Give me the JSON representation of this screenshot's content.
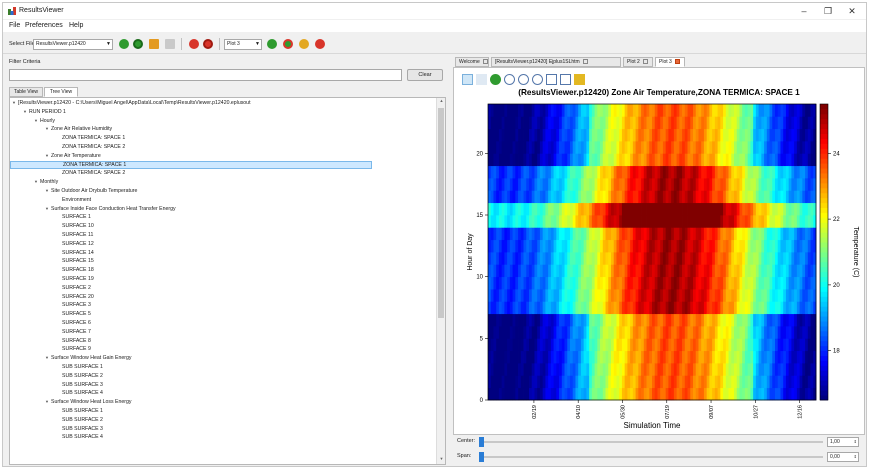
{
  "window": {
    "title": "ResultsViewer"
  },
  "menu": [
    "File",
    "Preferences",
    "Help"
  ],
  "toolbar": {
    "select_label": "Select File",
    "file_value": "ResultsViewer.p12420",
    "plot_value": "Plot 3"
  },
  "left": {
    "filter_label": "Filter Criteria",
    "filter_value": "",
    "clear_label": "Clear",
    "tabs": [
      "Table View",
      "Tree View"
    ],
    "tree": [
      {
        "text": "[ResultsViewer.p12420 - C:\\Users\\Miguel Angel\\AppData\\Local\\Temp\\ResultsViewer.p12420.eplusout",
        "depth": 0,
        "exp": true
      },
      {
        "text": "RUN PERIOD 1",
        "depth": 1,
        "exp": true
      },
      {
        "text": "Hourly",
        "depth": 2,
        "exp": true
      },
      {
        "text": "Zone Air Relative Humidity",
        "depth": 3,
        "exp": true
      },
      {
        "text": "ZONA TERMICA: SPACE 1",
        "depth": 4
      },
      {
        "text": "ZONA TERMICA: SPACE 2",
        "depth": 4
      },
      {
        "text": "Zone Air Temperature",
        "depth": 3,
        "exp": true
      },
      {
        "text": "ZONA TERMICA: SPACE 1",
        "depth": 4,
        "sel": true
      },
      {
        "text": "ZONA TERMICA: SPACE 2",
        "depth": 4
      },
      {
        "text": "Monthly",
        "depth": 2,
        "exp": true
      },
      {
        "text": "Site Outdoor Air Drybulb Temperature",
        "depth": 3,
        "exp": true
      },
      {
        "text": "Environment",
        "depth": 4
      },
      {
        "text": "Surface Inside Face Conduction Heat Transfer Energy",
        "depth": 3,
        "exp": true
      },
      {
        "text": "SURFACE 1",
        "depth": 4
      },
      {
        "text": "SURFACE 10",
        "depth": 4
      },
      {
        "text": "SURFACE 11",
        "depth": 4
      },
      {
        "text": "SURFACE 12",
        "depth": 4
      },
      {
        "text": "SURFACE 14",
        "depth": 4
      },
      {
        "text": "SURFACE 15",
        "depth": 4
      },
      {
        "text": "SURFACE 18",
        "depth": 4
      },
      {
        "text": "SURFACE 19",
        "depth": 4
      },
      {
        "text": "SURFACE 2",
        "depth": 4
      },
      {
        "text": "SURFACE 20",
        "depth": 4
      },
      {
        "text": "SURFACE 3",
        "depth": 4
      },
      {
        "text": "SURFACE 5",
        "depth": 4
      },
      {
        "text": "SURFACE 6",
        "depth": 4
      },
      {
        "text": "SURFACE 7",
        "depth": 4
      },
      {
        "text": "SURFACE 8",
        "depth": 4
      },
      {
        "text": "SURFACE 9",
        "depth": 4
      },
      {
        "text": "Surface Window Heat Gain Energy",
        "depth": 3,
        "exp": true
      },
      {
        "text": "SUB SURFACE 1",
        "depth": 4
      },
      {
        "text": "SUB SURFACE 2",
        "depth": 4
      },
      {
        "text": "SUB SURFACE 3",
        "depth": 4
      },
      {
        "text": "SUB SURFACE 4",
        "depth": 4
      },
      {
        "text": "Surface Window Heat Loss Energy",
        "depth": 3,
        "exp": true
      },
      {
        "text": "SUB SURFACE 1",
        "depth": 4
      },
      {
        "text": "SUB SURFACE 2",
        "depth": 4
      },
      {
        "text": "SUB SURFACE 3",
        "depth": 4
      },
      {
        "text": "SUB SURFACE 4",
        "depth": 4
      }
    ]
  },
  "right": {
    "tabs": [
      "Welcome",
      "[ResultsViewer.p12420] Ejplus1SLhtm",
      "Plot 2",
      "Plot 3"
    ],
    "active_tab": 3,
    "center_label": "Center:",
    "span_label": "Span:",
    "center_value": "1,00",
    "span_value": "0,00"
  },
  "chart_data": {
    "type": "heatmap",
    "title": "(ResultsViewer.p12420) Zone Air Temperature,ZONA TERMICA: SPACE 1",
    "xlabel": "Simulation Time",
    "ylabel": "Hour of Day",
    "colorbar_label": "Temperature (C)",
    "x_ticks": [
      "02/19",
      "04/10",
      "05/30",
      "07/19",
      "09/07",
      "10/27",
      "12/16"
    ],
    "y_ticks": [
      0,
      5,
      10,
      15,
      20
    ],
    "ylim": [
      0,
      24
    ],
    "colorbar_ticks": [
      18,
      20,
      22,
      24
    ],
    "colorbar_range": [
      16.5,
      25.5
    ],
    "notes": "Daily columns across the year; cool (blue) in winter months, warm (red) mid-year peaking ~24-25C in late summer; warm band around hours 14-15 and occupancy step near hours 7-18."
  }
}
